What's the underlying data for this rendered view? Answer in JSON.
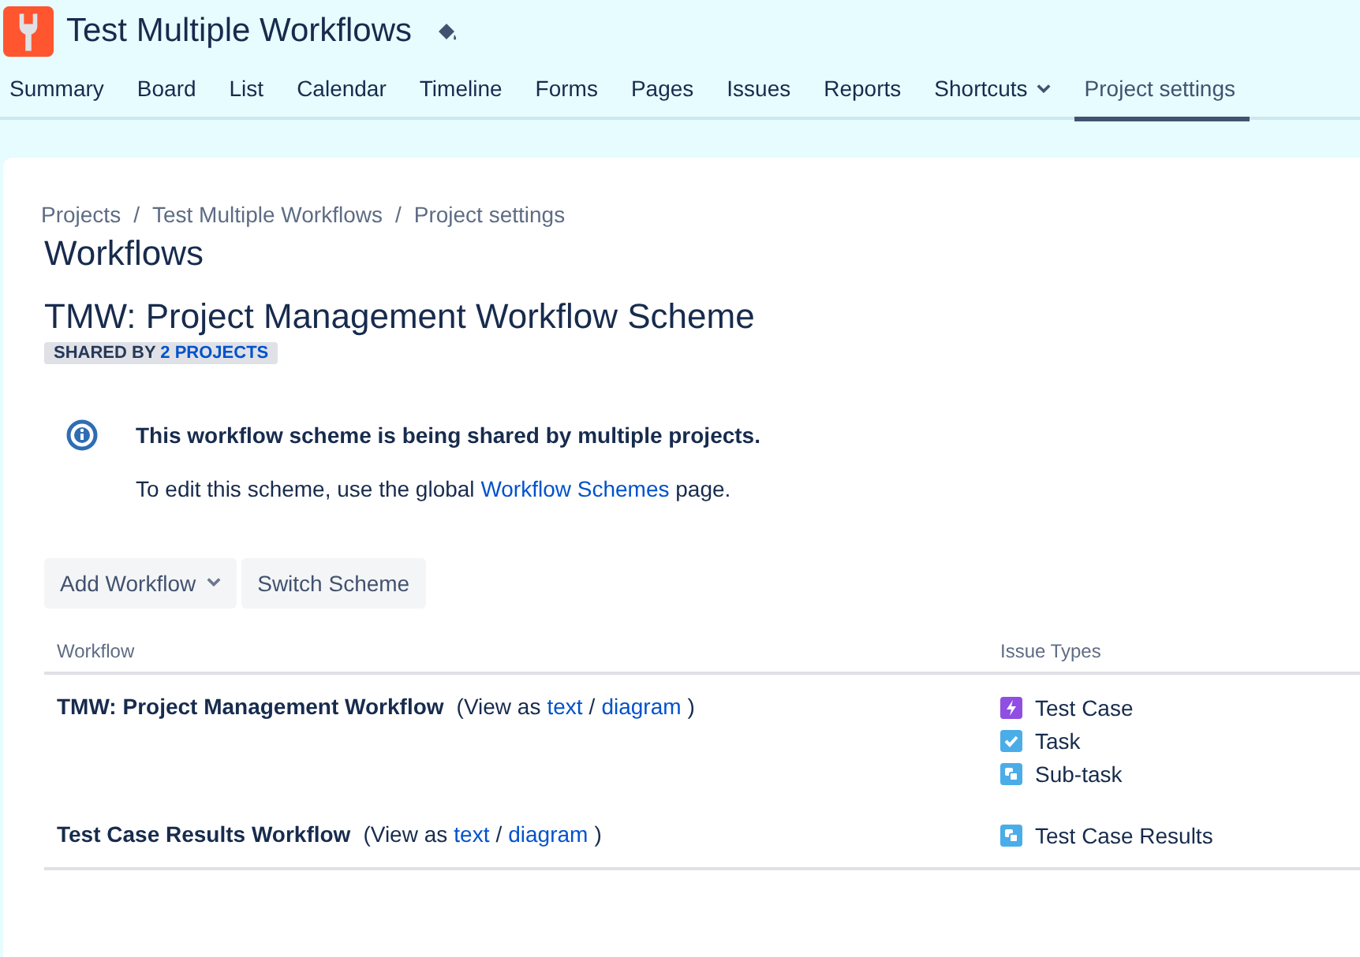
{
  "project": {
    "title": "Test Multiple Workflows"
  },
  "tabs": [
    {
      "label": "Summary",
      "selected": false,
      "dropdown": false
    },
    {
      "label": "Board",
      "selected": false,
      "dropdown": false
    },
    {
      "label": "List",
      "selected": false,
      "dropdown": false
    },
    {
      "label": "Calendar",
      "selected": false,
      "dropdown": false
    },
    {
      "label": "Timeline",
      "selected": false,
      "dropdown": false
    },
    {
      "label": "Forms",
      "selected": false,
      "dropdown": false
    },
    {
      "label": "Pages",
      "selected": false,
      "dropdown": false
    },
    {
      "label": "Issues",
      "selected": false,
      "dropdown": false
    },
    {
      "label": "Reports",
      "selected": false,
      "dropdown": false
    },
    {
      "label": "Shortcuts",
      "selected": false,
      "dropdown": true
    },
    {
      "label": "Project settings",
      "selected": true,
      "dropdown": false
    }
  ],
  "breadcrumbs": [
    {
      "label": "Projects"
    },
    {
      "separator": "/",
      "label": "Test Multiple Workflows"
    },
    {
      "separator": "/",
      "label": "Project settings"
    }
  ],
  "page_title": "Workflows",
  "scheme": {
    "title": "TMW: Project Management Workflow Scheme",
    "badge_label": "SHARED BY",
    "badge_link": "2 PROJECTS"
  },
  "message": {
    "title": "This workflow scheme is being shared by multiple projects.",
    "text_before": "To edit this scheme, use the global",
    "link": "Workflow Schemes",
    "text_after": "page."
  },
  "buttons": [
    {
      "label": "Add Workflow",
      "dropdown": true
    },
    {
      "label": "Switch Scheme",
      "dropdown": false
    }
  ],
  "table": {
    "columns": [
      "Workflow",
      "Issue Types"
    ],
    "rows": [
      {
        "name": "TMW: Project Management Workflow",
        "view_prefix": "(View as",
        "text_link": "text",
        "separator": "/",
        "diagram_link": "diagram",
        "suffix": ")",
        "issue_types": [
          {
            "label": "Test Case",
            "kind": "bolt"
          },
          {
            "label": "Task",
            "kind": "check"
          },
          {
            "label": "Sub-task",
            "kind": "subtask"
          }
        ]
      },
      {
        "name": "Test Case Results Workflow",
        "view_prefix": "(View as",
        "text_link": "text",
        "separator": "/",
        "diagram_link": "diagram",
        "suffix": ")",
        "issue_types": [
          {
            "label": "Test Case Results",
            "kind": "subtask"
          }
        ]
      }
    ]
  }
}
